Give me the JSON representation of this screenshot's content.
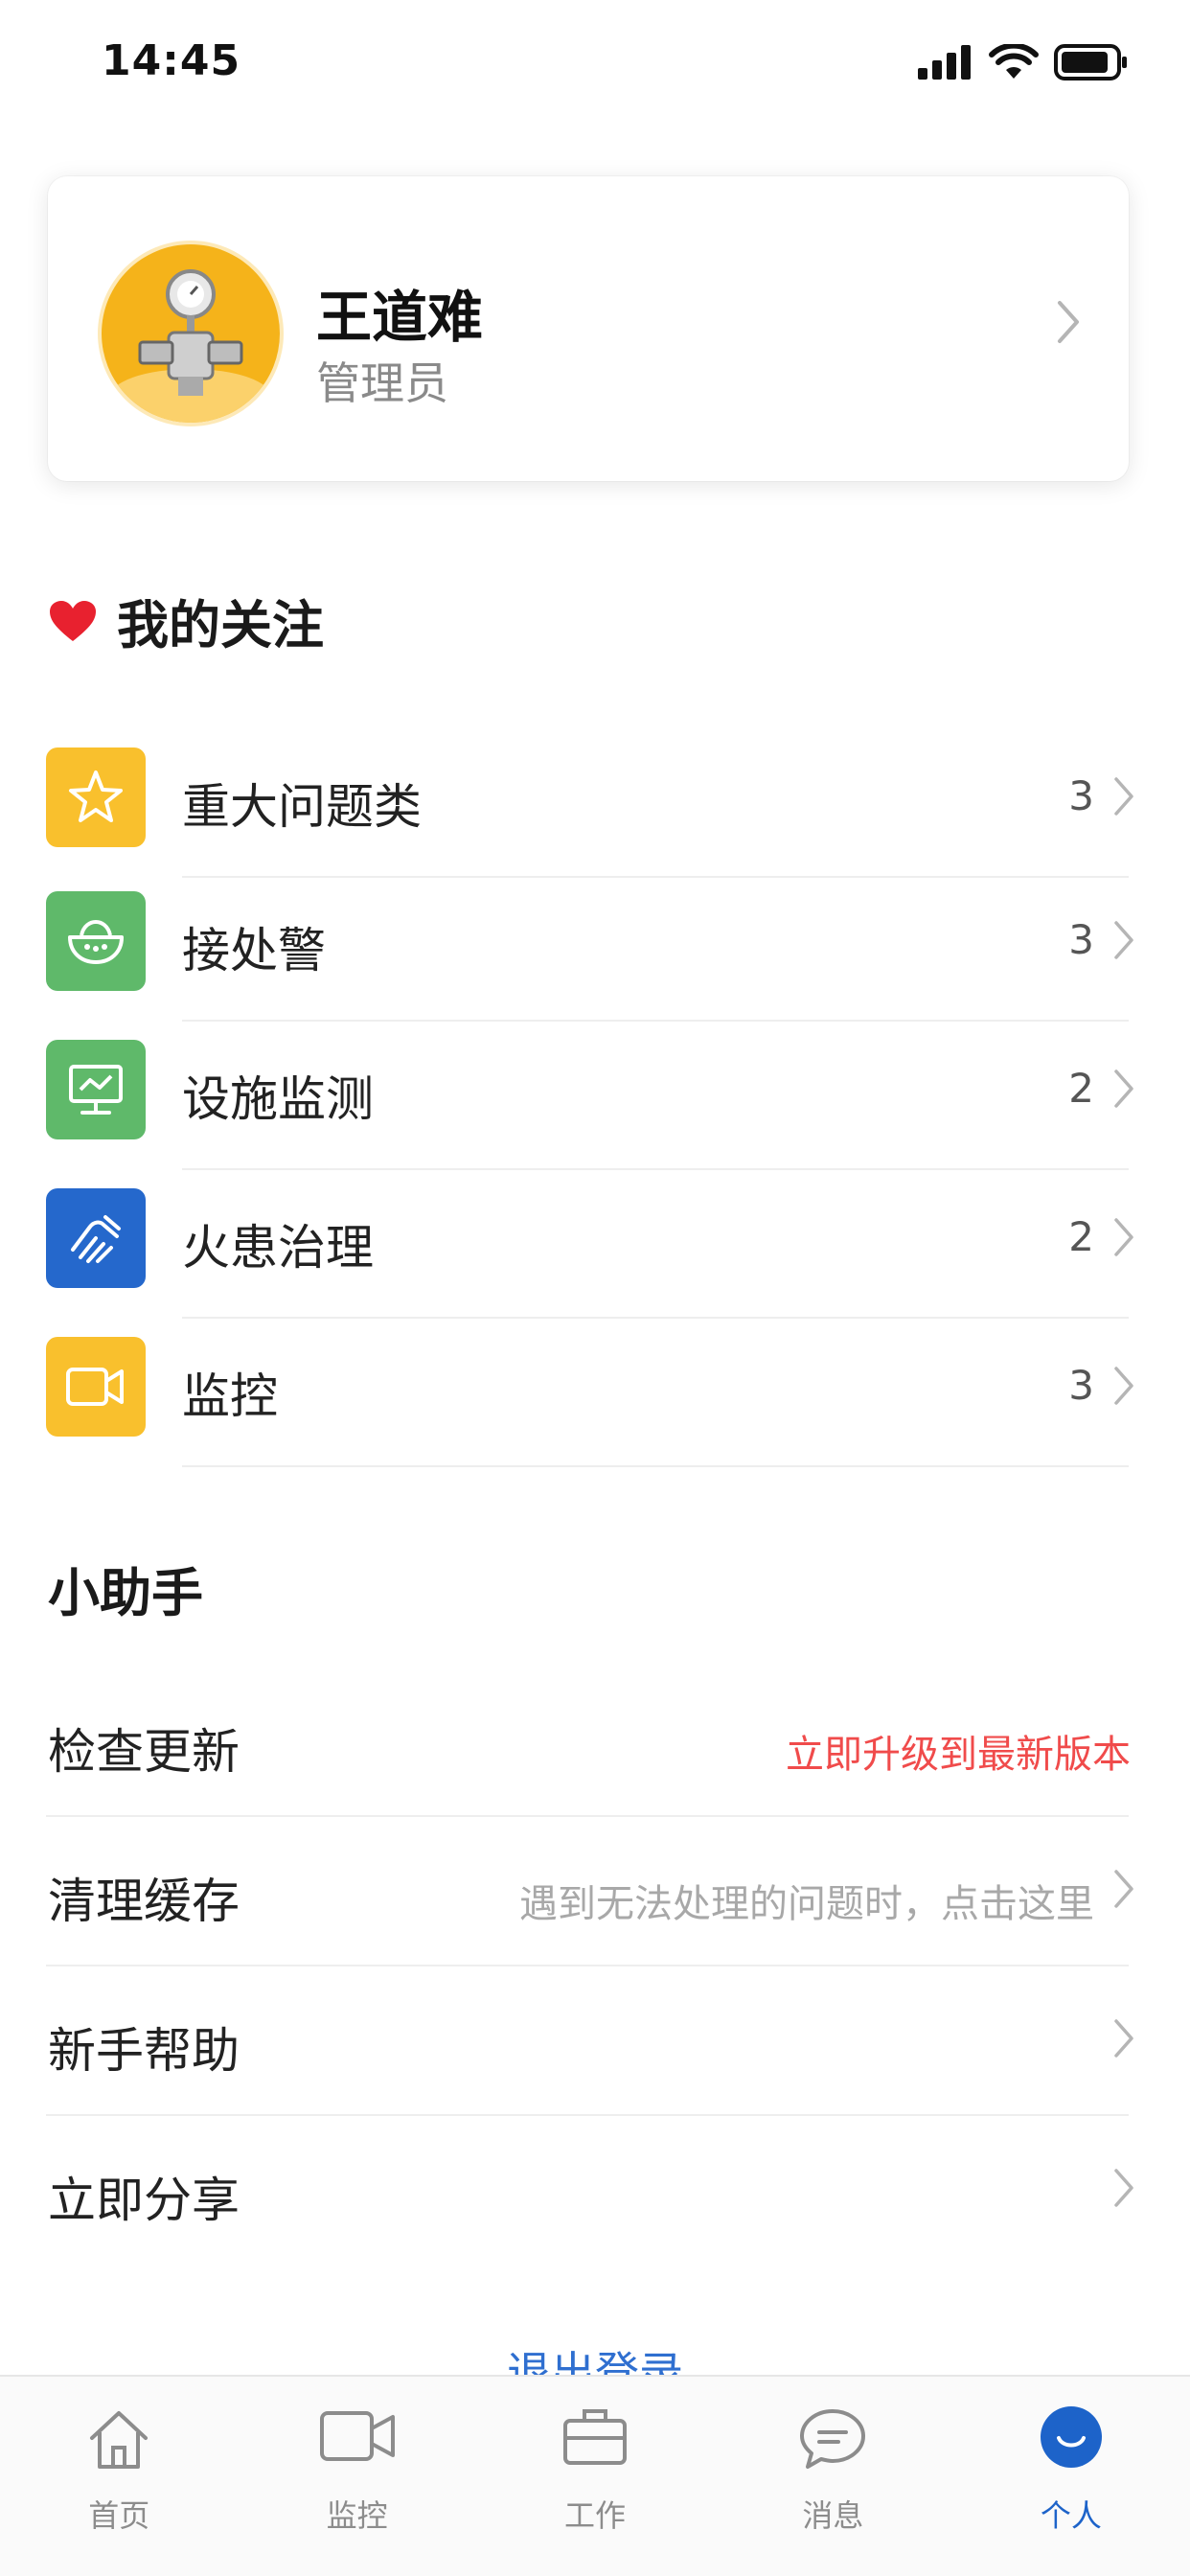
{
  "status_bar": {
    "time": "14:45"
  },
  "profile": {
    "name": "王道难",
    "role": "管理员"
  },
  "follow_section": {
    "title": "我的关注",
    "items": [
      {
        "label": "重大问题类",
        "count": "3",
        "icon": "star-icon",
        "color": "#f9c02d"
      },
      {
        "label": "接处警",
        "count": "3",
        "icon": "bowl-icon",
        "color": "#5fb96a"
      },
      {
        "label": "设施监测",
        "count": "2",
        "icon": "monitor-icon",
        "color": "#5fb96a"
      },
      {
        "label": "火患治理",
        "count": "2",
        "icon": "hand-icon",
        "color": "#2568cc"
      },
      {
        "label": "监控",
        "count": "3",
        "icon": "camera-icon",
        "color": "#f9c02d"
      }
    ]
  },
  "assistant_section": {
    "title": "小助手",
    "items": [
      {
        "label": "检查更新",
        "hint": "立即升级到最新版本"
      },
      {
        "label": "清理缓存",
        "hint": "遇到无法处理的问题时，点击这里"
      },
      {
        "label": "新手帮助",
        "hint": ""
      },
      {
        "label": "立即分享",
        "hint": ""
      }
    ]
  },
  "logout_label": "退出登录",
  "tabs": [
    {
      "label": "首页",
      "icon": "home-icon"
    },
    {
      "label": "监控",
      "icon": "camera-icon"
    },
    {
      "label": "工作",
      "icon": "briefcase-icon"
    },
    {
      "label": "消息",
      "icon": "chat-icon"
    },
    {
      "label": "个人",
      "icon": "person-icon",
      "active": true
    }
  ],
  "colors": {
    "accent": "#1d63c9",
    "danger": "#f04b4b",
    "heart": "#e8212f"
  }
}
